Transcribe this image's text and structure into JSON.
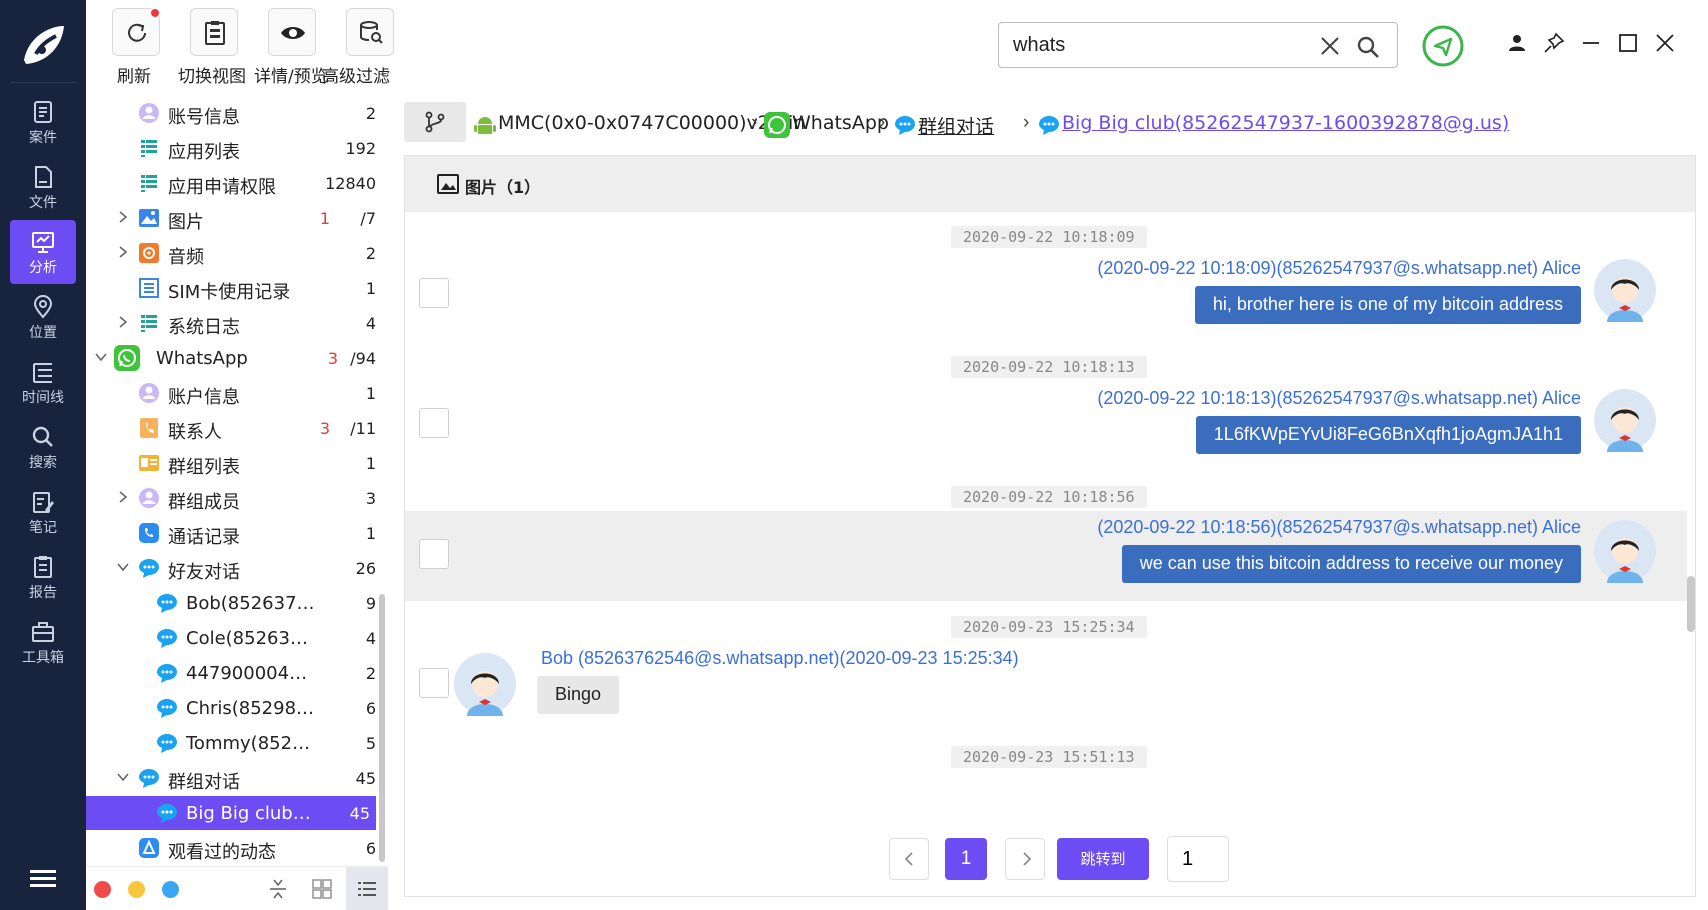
{
  "nav": {
    "items": [
      {
        "label": "案件",
        "icon": "case-icon"
      },
      {
        "label": "文件",
        "icon": "file-icon"
      },
      {
        "label": "分析",
        "icon": "analysis-icon",
        "active": true
      },
      {
        "label": "位置",
        "icon": "location-icon"
      },
      {
        "label": "时间线",
        "icon": "timeline-icon"
      },
      {
        "label": "搜索",
        "icon": "search-icon"
      },
      {
        "label": "笔记",
        "icon": "note-icon"
      },
      {
        "label": "报告",
        "icon": "report-icon"
      },
      {
        "label": "工具箱",
        "icon": "toolbox-icon"
      }
    ],
    "accent": "#6c4cf3",
    "background": "#18243d"
  },
  "toolbar": {
    "refresh": "刷新",
    "switch_view": "切换视图",
    "details": "详情/预览",
    "advanced_filter": "高级过滤"
  },
  "search": {
    "value": "whats"
  },
  "tree": {
    "items": [
      {
        "label": "账号信息",
        "count": "2",
        "icon": "account-icon"
      },
      {
        "label": "应用列表",
        "count": "192",
        "icon": "list-icon"
      },
      {
        "label": "应用申请权限",
        "count": "12840",
        "icon": "list-icon"
      },
      {
        "label": "图片",
        "hl": "1",
        "count": "/7",
        "icon": "image-icon"
      },
      {
        "label": "音频",
        "count": "2",
        "icon": "audio-icon"
      },
      {
        "label": "SIM卡使用记录",
        "count": "1",
        "icon": "list-icon"
      },
      {
        "label": "系统日志",
        "count": "4",
        "icon": "list-icon"
      },
      {
        "label": "WhatsApp",
        "hl": "3",
        "count": "/94",
        "icon": "whatsapp-icon"
      },
      {
        "label": "账户信息",
        "count": "1",
        "icon": "account-icon"
      },
      {
        "label": "联系人",
        "hl": "3",
        "count": "/11",
        "icon": "contacts-icon"
      },
      {
        "label": "群组列表",
        "count": "1",
        "icon": "group-list-icon"
      },
      {
        "label": "群组成员",
        "count": "3",
        "icon": "account-icon"
      },
      {
        "label": "通话记录",
        "count": "1",
        "icon": "call-icon"
      },
      {
        "label": "好友对话",
        "count": "26",
        "icon": "chat-icon"
      },
      {
        "label": "Bob(8526376...",
        "count": "9",
        "icon": "chat-icon"
      },
      {
        "label": "Cole(8526376...",
        "count": "4",
        "icon": "chat-icon"
      },
      {
        "label": "44790000440...",
        "count": "2",
        "icon": "chat-icon"
      },
      {
        "label": "Chris(852988...",
        "count": "6",
        "icon": "chat-icon"
      },
      {
        "label": "Tommy(8529...",
        "count": "5",
        "icon": "chat-icon"
      },
      {
        "label": "群组对话",
        "count": "45",
        "icon": "chat-icon"
      },
      {
        "label": "Big Big club(...",
        "count": "45",
        "icon": "chat-icon",
        "selected": true
      },
      {
        "label": "观看过的动态",
        "count": "6",
        "icon": "status-icon"
      }
    ]
  },
  "breadcrumb": {
    "items": [
      "MMC(0x0-0x0747C00000)v2.bin",
      "WhatsApp",
      "群组对话",
      "Big Big club(85262547937-1600392878@g.us)"
    ]
  },
  "panel": {
    "header": "图片（1）"
  },
  "messages": [
    {
      "timestamp": "2020-09-22 10:18:09",
      "sender": "(2020-09-22 10:18:09)(85262547937@s.whatsapp.net) Alice",
      "text": "hi, brother  here is one of my bitcoin address",
      "direction": "out"
    },
    {
      "timestamp": "2020-09-22 10:18:13",
      "sender": "(2020-09-22 10:18:13)(85262547937@s.whatsapp.net) Alice",
      "text": "1L6fKWpEYvUi8FeG6BnXqfh1joAgmJA1h1",
      "direction": "out"
    },
    {
      "timestamp": "2020-09-22 10:18:56",
      "sender": "(2020-09-22 10:18:56)(85262547937@s.whatsapp.net) Alice",
      "text": "we can use this bitcoin address to receive our money",
      "direction": "out",
      "highlighted": true
    },
    {
      "timestamp": "2020-09-23 15:25:34",
      "sender": "Bob (85263762546@s.whatsapp.net)(2020-09-23 15:25:34)",
      "text": "Bingo",
      "direction": "in"
    },
    {
      "timestamp": "2020-09-23 15:51:13"
    }
  ],
  "pagination": {
    "current": "1",
    "jump_label": "跳转到",
    "jump_value": "1"
  }
}
